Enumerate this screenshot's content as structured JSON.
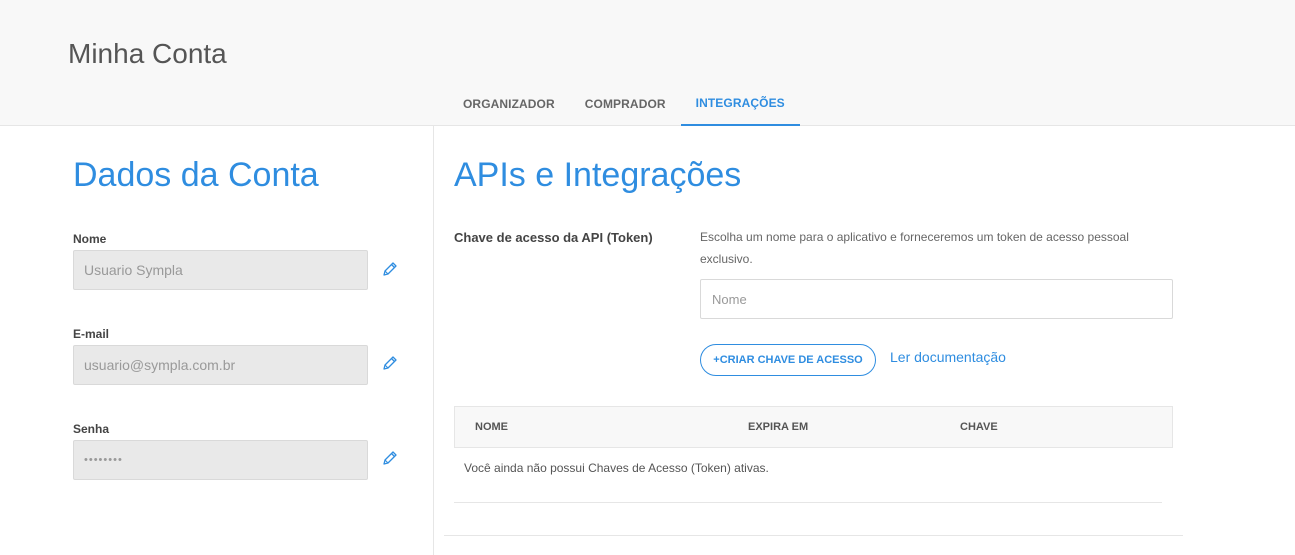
{
  "header": {
    "title": "Minha Conta",
    "tabs": [
      {
        "label": "ORGANIZADOR",
        "active": false
      },
      {
        "label": "COMPRADOR",
        "active": false
      },
      {
        "label": "INTEGRAÇÕES",
        "active": true
      }
    ]
  },
  "account": {
    "title": "Dados da Conta",
    "fields": [
      {
        "label": "Nome",
        "value": "Usuario Sympla",
        "icon": "pencil-icon"
      },
      {
        "label": "E-mail",
        "value": "usuario@sympla.com.br",
        "icon": "pencil-icon"
      },
      {
        "label": "Senha",
        "value": "••••••••",
        "icon": "pencil-icon"
      }
    ]
  },
  "integrations": {
    "title": "APIs e Integrações",
    "token_label": "Chave de acesso da API (Token)",
    "token_description": "Escolha um nome para o aplicativo e forneceremos um token de acesso pessoal exclusivo.",
    "name_placeholder": "Nome",
    "create_button": "+CRIAR CHAVE DE ACESSO",
    "doc_link": "Ler documentação",
    "table": {
      "columns": [
        "NOME",
        "EXPIRA EM",
        "CHAVE"
      ],
      "empty_message": "Você ainda não possui Chaves de Acesso (Token) ativas."
    }
  },
  "colors": {
    "accent": "#2f8de0",
    "header_bg": "#f8f8f8",
    "field_bg": "#e9e9e9"
  }
}
